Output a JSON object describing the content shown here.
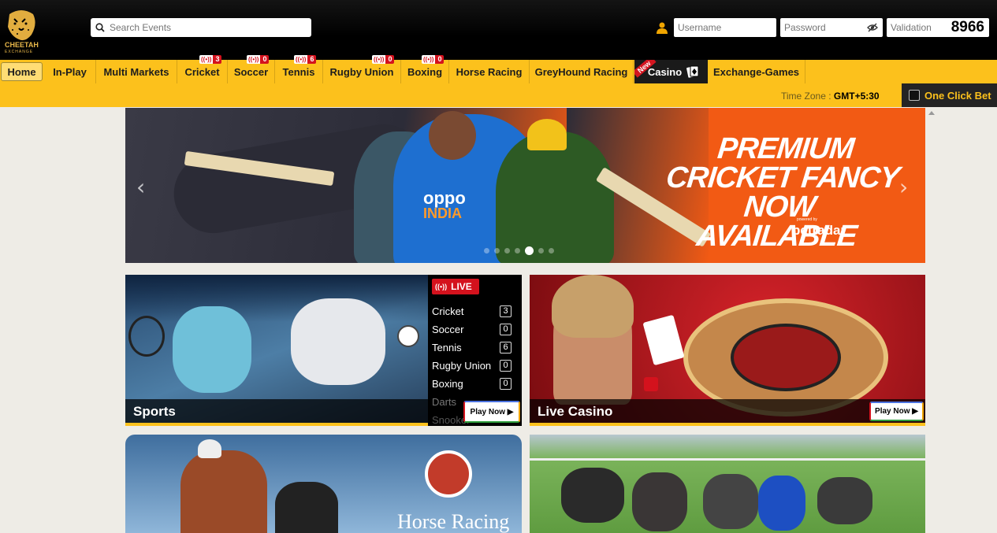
{
  "header": {
    "logo_text": "CHEETAH",
    "logo_sub": "EXCHANGE",
    "search_placeholder": "Search Events",
    "username_placeholder": "Username",
    "password_placeholder": "Password",
    "validation_placeholder": "Validation",
    "validation_code": "8966"
  },
  "nav": {
    "items": [
      {
        "label": "Home"
      },
      {
        "label": "In-Play"
      },
      {
        "label": "Multi Markets"
      },
      {
        "label": "Cricket",
        "live": "3"
      },
      {
        "label": "Soccer",
        "live": "0"
      },
      {
        "label": "Tennis",
        "live": "6"
      },
      {
        "label": "Rugby Union",
        "live": "0"
      },
      {
        "label": "Boxing",
        "live": "0"
      },
      {
        "label": "Horse Racing"
      },
      {
        "label": "GreyHound Racing"
      },
      {
        "label": "Casino",
        "ribbon": "New"
      },
      {
        "label": "Exchange-Games"
      }
    ]
  },
  "subbar": {
    "timezone_label": "Time Zone :",
    "timezone_value": "GMT+5:30",
    "one_click_label": "One Click Bet"
  },
  "banner": {
    "line1": "PREMIUM",
    "line2": "CRICKET FANCY",
    "line3": "NOW AVAILABLE",
    "powered_by": "powered by",
    "brand": "betradar",
    "jersey": "INDIA",
    "sponsor": "oppo",
    "slide_count": 7,
    "active_slide": 5
  },
  "cards": {
    "sports": {
      "label": "Sports",
      "play": "Play Now ▶"
    },
    "casino": {
      "label": "Live Casino",
      "play": "Play Now ▶"
    },
    "horse": {
      "title": "Horse Racing"
    }
  },
  "live_panel": {
    "header": "LIVE",
    "rows": [
      {
        "name": "Cricket",
        "count": "3"
      },
      {
        "name": "Soccer",
        "count": "0"
      },
      {
        "name": "Tennis",
        "count": "6"
      },
      {
        "name": "Rugby Union",
        "count": "0"
      },
      {
        "name": "Boxing",
        "count": "0"
      },
      {
        "name": "Darts",
        "count": ""
      },
      {
        "name": "Snooker",
        "count": ""
      }
    ]
  },
  "colors": {
    "accent": "#fcc11c",
    "banner_orange": "#f25a14",
    "live_red": "#d4121d"
  }
}
